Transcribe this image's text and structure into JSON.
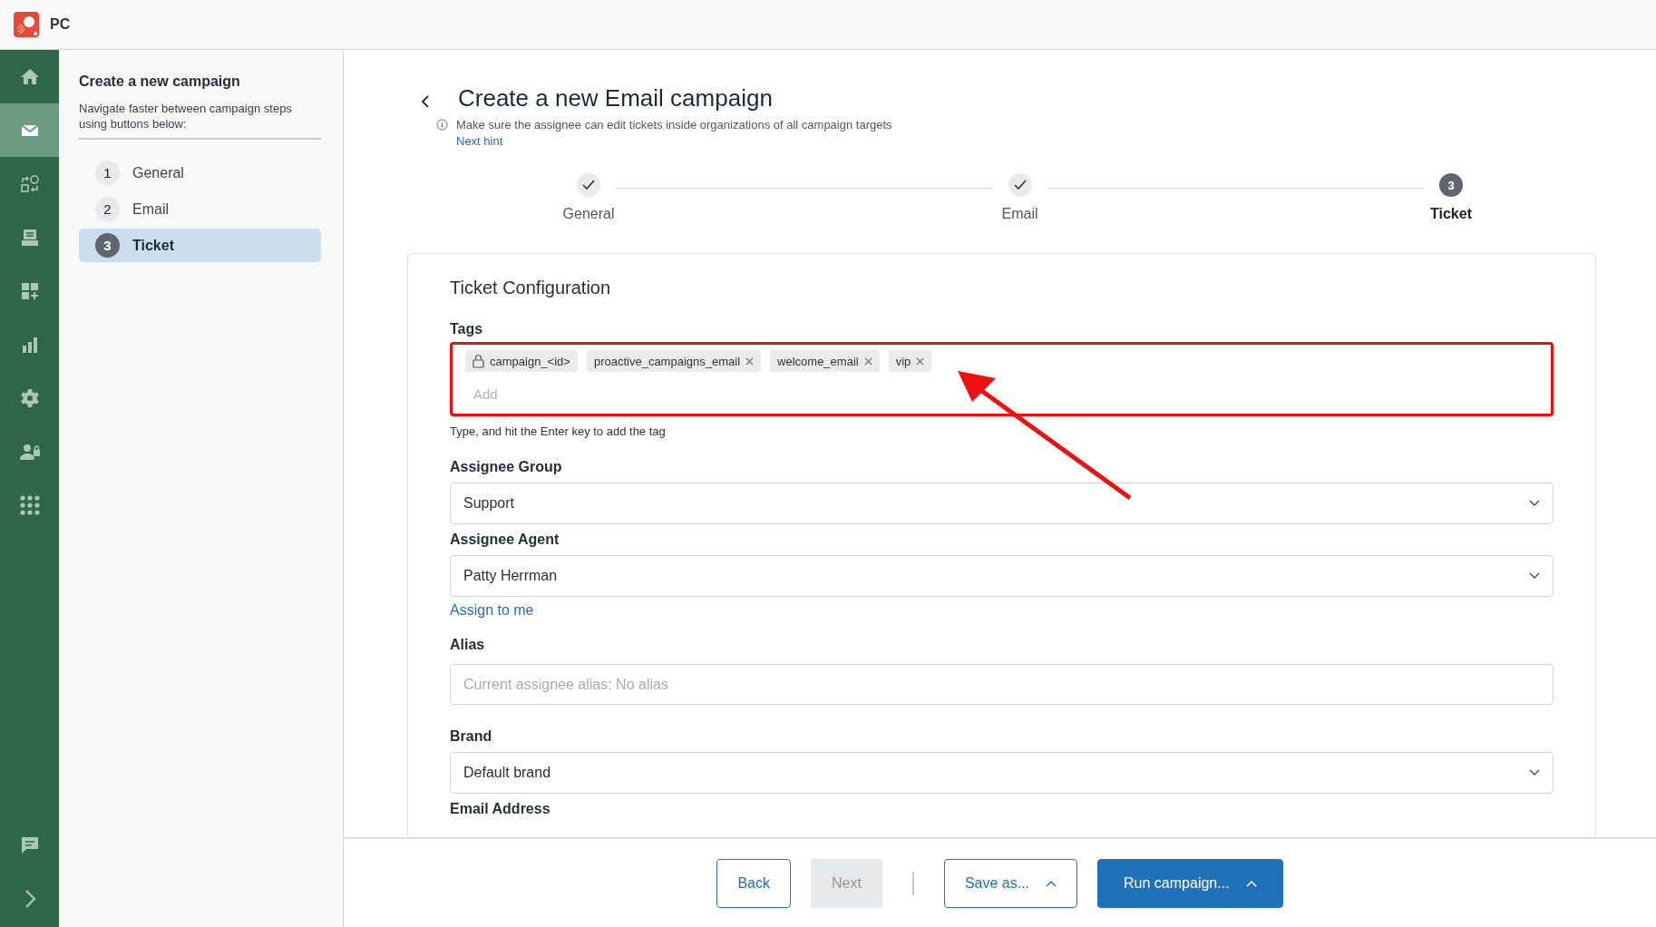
{
  "app": {
    "name": "PC"
  },
  "rail": {
    "items": [
      {
        "kind": "home",
        "selected": false
      },
      {
        "kind": "mail",
        "selected": true
      },
      {
        "kind": "shapes",
        "selected": false
      },
      {
        "kind": "inbox",
        "selected": false
      },
      {
        "kind": "widgets",
        "selected": false
      },
      {
        "kind": "chart",
        "selected": false
      },
      {
        "kind": "gear",
        "selected": false
      },
      {
        "kind": "user-lock",
        "selected": false
      },
      {
        "kind": "grid",
        "selected": false
      }
    ],
    "bottom": [
      {
        "kind": "chat",
        "selected": false
      },
      {
        "kind": "expand",
        "selected": false
      }
    ]
  },
  "steps_panel": {
    "title": "Create a new campaign",
    "description": "Navigate faster between campaign steps using buttons below:",
    "steps": [
      {
        "number": "1",
        "label": "General",
        "selected": false
      },
      {
        "number": "2",
        "label": "Email",
        "selected": false
      },
      {
        "number": "3",
        "label": "Ticket",
        "selected": true
      }
    ]
  },
  "header": {
    "title": "Create a new Email campaign",
    "hint": "Make sure the assignee can edit tickets inside organizations of all campaign targets",
    "hint_link": "Next hint"
  },
  "stepper": [
    {
      "label": "General",
      "done": true,
      "selected": false
    },
    {
      "label": "Email",
      "done": true,
      "selected": false
    },
    {
      "label": "Ticket",
      "number": "3",
      "done": false,
      "selected": true
    }
  ],
  "card": {
    "title": "Ticket Configuration",
    "tags_field": {
      "label": "Tags",
      "highlighted": true,
      "placeholder": "Add",
      "help": "Type, and hit the Enter key to add the tag",
      "tags": [
        {
          "text": "campaign_<id>",
          "locked": true
        },
        {
          "text": "proactive_campaigns_email",
          "locked": false
        },
        {
          "text": "welcome_email",
          "locked": false
        },
        {
          "text": "vip",
          "locked": false
        }
      ]
    },
    "fields": [
      {
        "kind": "select",
        "label": "Assignee Group",
        "value": "Support"
      },
      {
        "kind": "select",
        "label": "Assignee Agent",
        "value": "Patty Herrman",
        "link": "Assign to me"
      },
      {
        "kind": "input",
        "label": "Alias",
        "placeholder": "Current assignee alias: No alias"
      },
      {
        "kind": "select",
        "label": "Brand",
        "value": "Default brand"
      },
      {
        "kind": "label",
        "label": "Email Address"
      }
    ]
  },
  "footer": [
    {
      "label": "Back",
      "kind": "outline",
      "dropdown": false
    },
    {
      "label": "Next",
      "kind": "disabled",
      "dropdown": false
    },
    {
      "kind": "separator"
    },
    {
      "label": "Save as...",
      "kind": "outline",
      "dropdown": true
    },
    {
      "label": "Run campaign...",
      "kind": "primary",
      "dropdown": true
    }
  ]
}
